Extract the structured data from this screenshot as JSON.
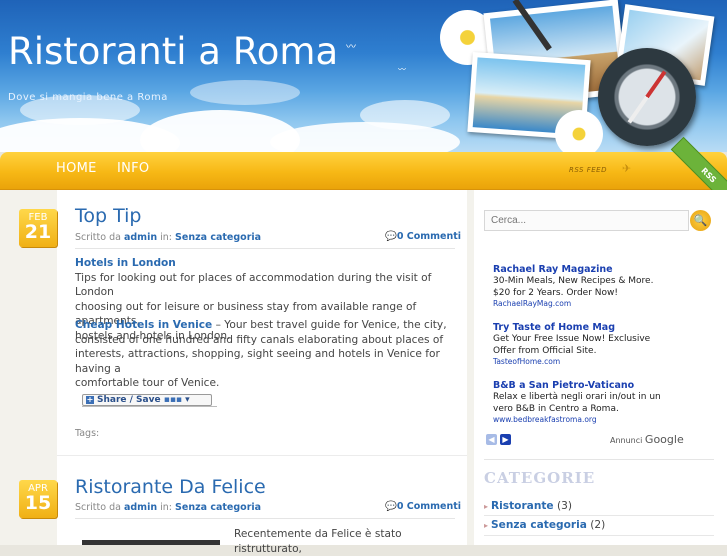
{
  "header": {
    "title": "Ristoranti a Roma",
    "description": "Dove si mangia bene a Roma"
  },
  "nav": {
    "items": [
      {
        "label": "HOME"
      },
      {
        "label": "INFO"
      }
    ],
    "rss_feed": "RSS FEED",
    "rss_ribbon": "RSS"
  },
  "posts": [
    {
      "month": "FEB",
      "day": "21",
      "title": "Top Tip",
      "meta_prefix": "Scritto da",
      "author": "admin",
      "meta_in": "in:",
      "category": "Senza categoria",
      "comments": "0 Commenti",
      "link1": "Hotels in London",
      "text1_lines": [
        "Tips for looking out for places of accommodation during the visit of London",
        "choosing out for leisure or business stay from available range of apartments,",
        "hostels and hotels in London."
      ],
      "link2": "Cheap Hotels in Venice",
      "text2_first": " – Your best travel guide for Venice, the city,",
      "text2_lines": [
        "consisted of one hundred and fifty canals elaborating about places of",
        "interests, attractions, shopping, sight seeing and hotels in Venice for having a",
        "comfortable tour of Venice."
      ],
      "share_label": "Share / Save",
      "tags_label": "Tags:"
    },
    {
      "month": "APR",
      "day": "15",
      "title": "Ristorante Da Felice",
      "meta_prefix": "Scritto da",
      "author": "admin",
      "meta_in": "in:",
      "category": "Senza categoria",
      "comments": "0 Commenti",
      "excerpt": "Recentemente da Felice è stato ristrutturato,"
    }
  ],
  "sidebar": {
    "search_placeholder": "Cerca...",
    "ads": [
      {
        "title": "Rachael Ray Magazine",
        "lines": [
          "30-Min Meals, New Recipes & More.",
          "$20 for 2 Years. Order Now!"
        ],
        "url": "RachaelRayMag.com"
      },
      {
        "title": "Try Taste of Home Mag",
        "lines": [
          "Get Your Free Issue Now! Exclusive",
          "Offer from Official Site."
        ],
        "url": "TasteofHome.com"
      },
      {
        "title": "B&B a San Pietro-Vaticano",
        "lines": [
          "Relax e libertà negli orari in/out in un",
          "vero B&B in Centro a Roma."
        ],
        "url": "www.bedbreakfastroma.org"
      }
    ],
    "ad_label_prefix": "Annunci",
    "ad_label_brand": "Google",
    "categories_heading": "CATEGORIE",
    "categories": [
      {
        "name": "Ristorante",
        "count": "(3)"
      },
      {
        "name": "Senza categoria",
        "count": "(2)"
      }
    ]
  },
  "colors": {
    "accent": "#f7b815",
    "link": "#2a6ab0",
    "header_sky": "#2f7fd0"
  }
}
